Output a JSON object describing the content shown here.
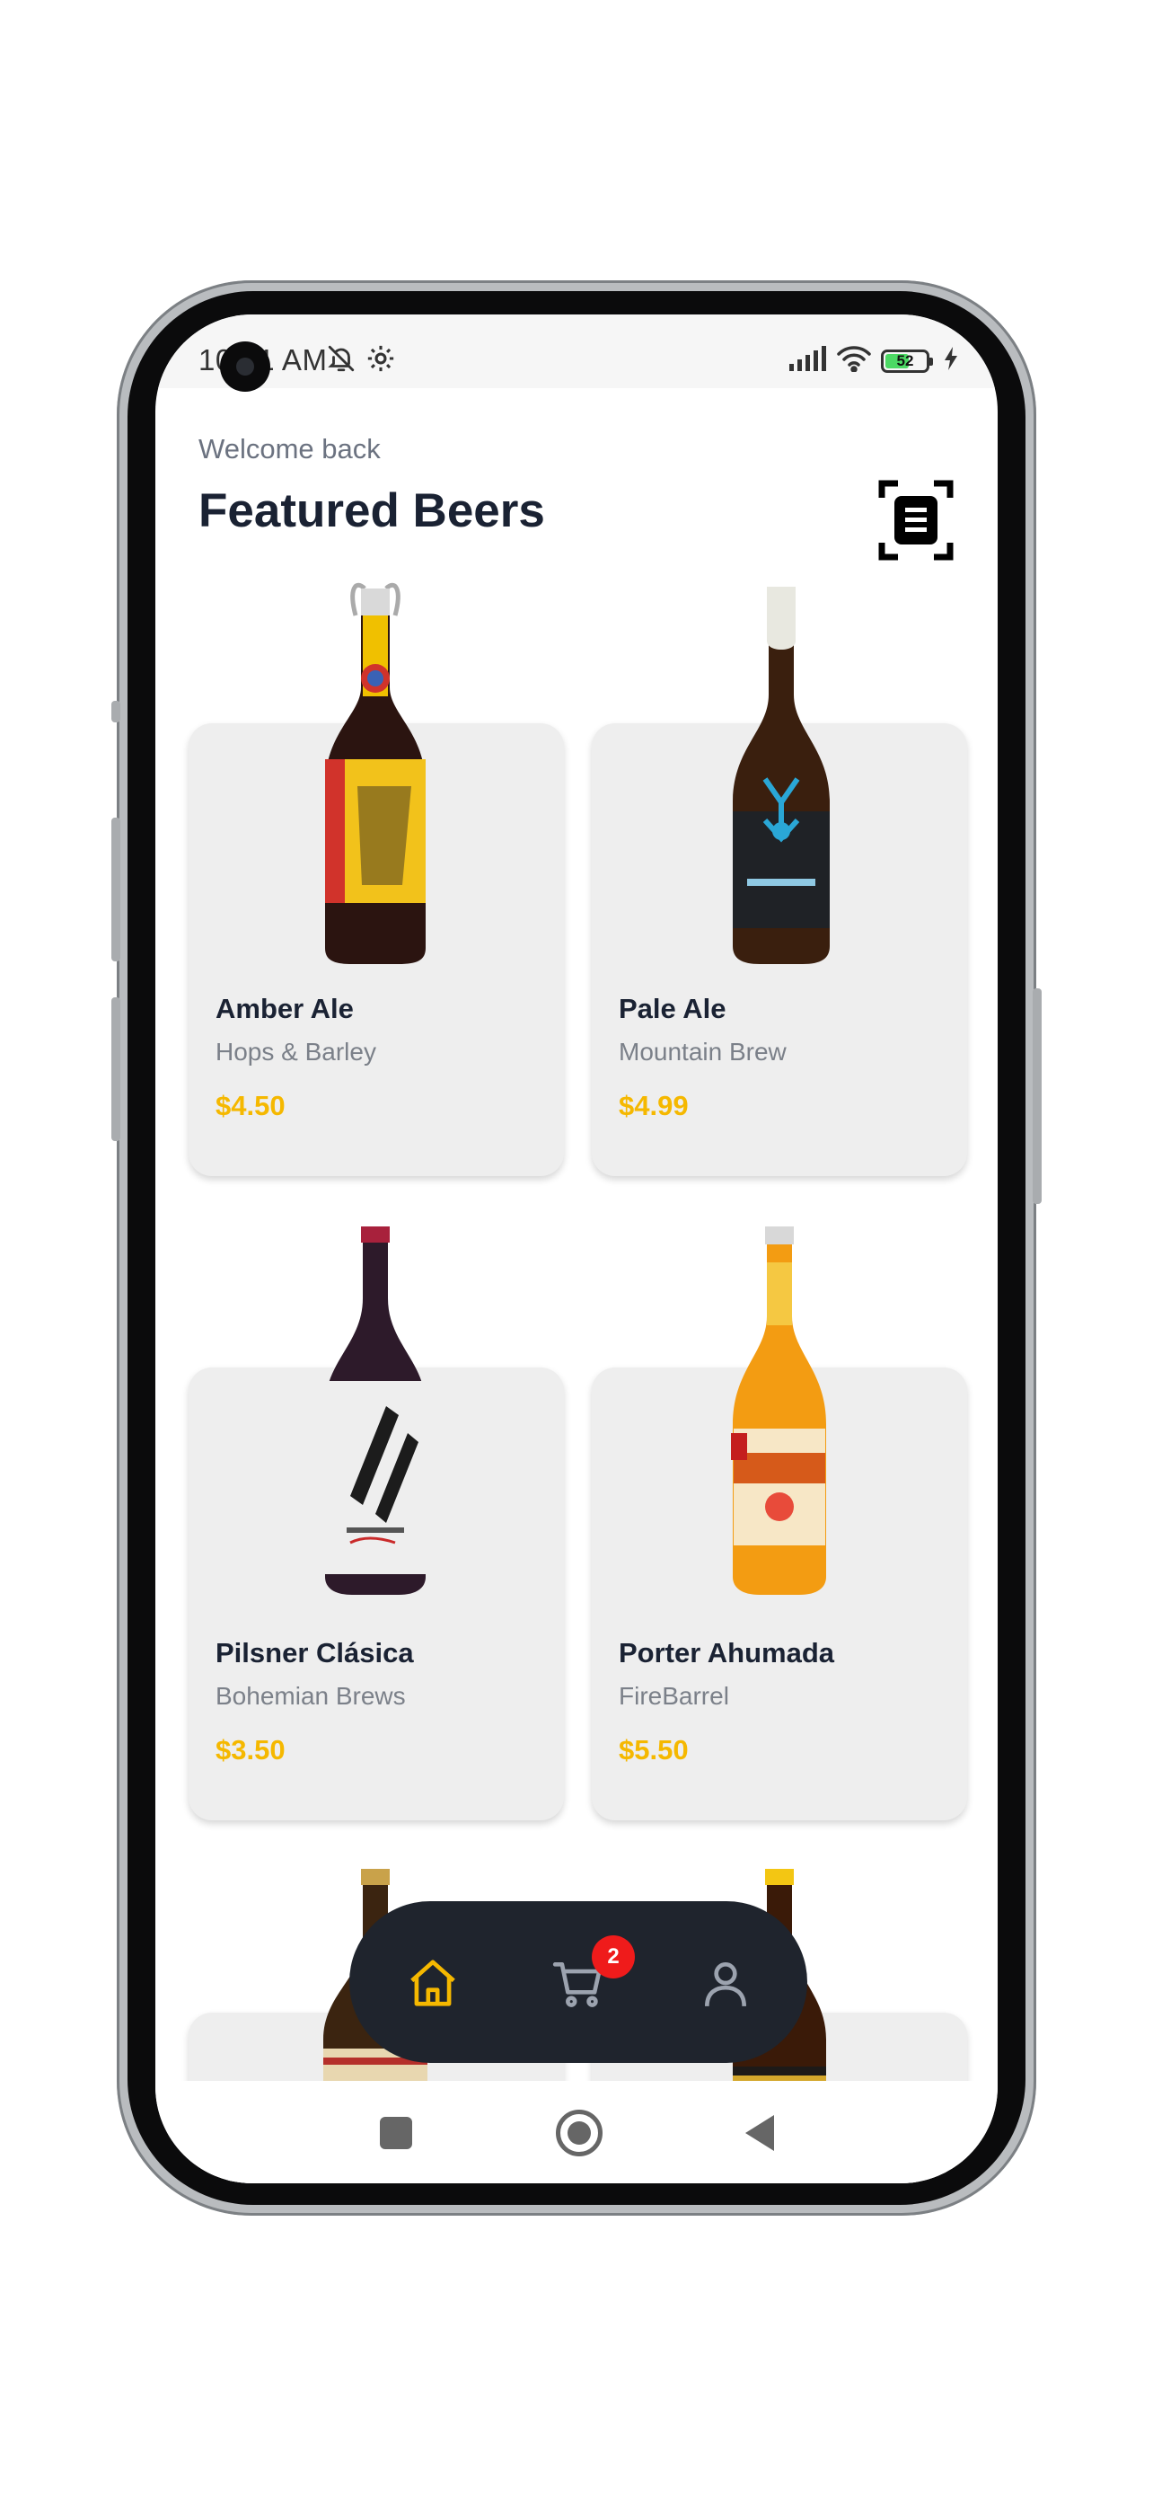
{
  "status_bar": {
    "time": "10:01 AM",
    "battery_level": "52",
    "icons": [
      "bell-muted-icon",
      "settings-icon",
      "signal-icon",
      "wifi-icon",
      "battery-icon",
      "charging-icon"
    ]
  },
  "header": {
    "welcome": "Welcome back",
    "title": "Featured Beers",
    "scan_icon": "scan-document-icon"
  },
  "products": [
    {
      "name": "Amber Ale",
      "brand": "Hops & Barley",
      "price": "$4.50"
    },
    {
      "name": "Pale Ale",
      "brand": "Mountain Brew",
      "price": "$4.99"
    },
    {
      "name": "Pilsner Clásica",
      "brand": "Bohemian Brews",
      "price": "$3.50"
    },
    {
      "name": "Porter Ahumada",
      "brand": "FireBarrel",
      "price": "$5.50"
    }
  ],
  "bottom_nav": {
    "items": [
      {
        "icon": "home-icon",
        "active": true
      },
      {
        "icon": "cart-icon",
        "active": false,
        "badge": "2"
      },
      {
        "icon": "profile-icon",
        "active": false
      }
    ],
    "active_color": "#f5b800"
  },
  "colors": {
    "accent": "#f5b800",
    "title": "#1a2233",
    "card_bg": "#eeeeee",
    "nav_bg": "#1f242d",
    "badge": "#ef1b1b"
  }
}
